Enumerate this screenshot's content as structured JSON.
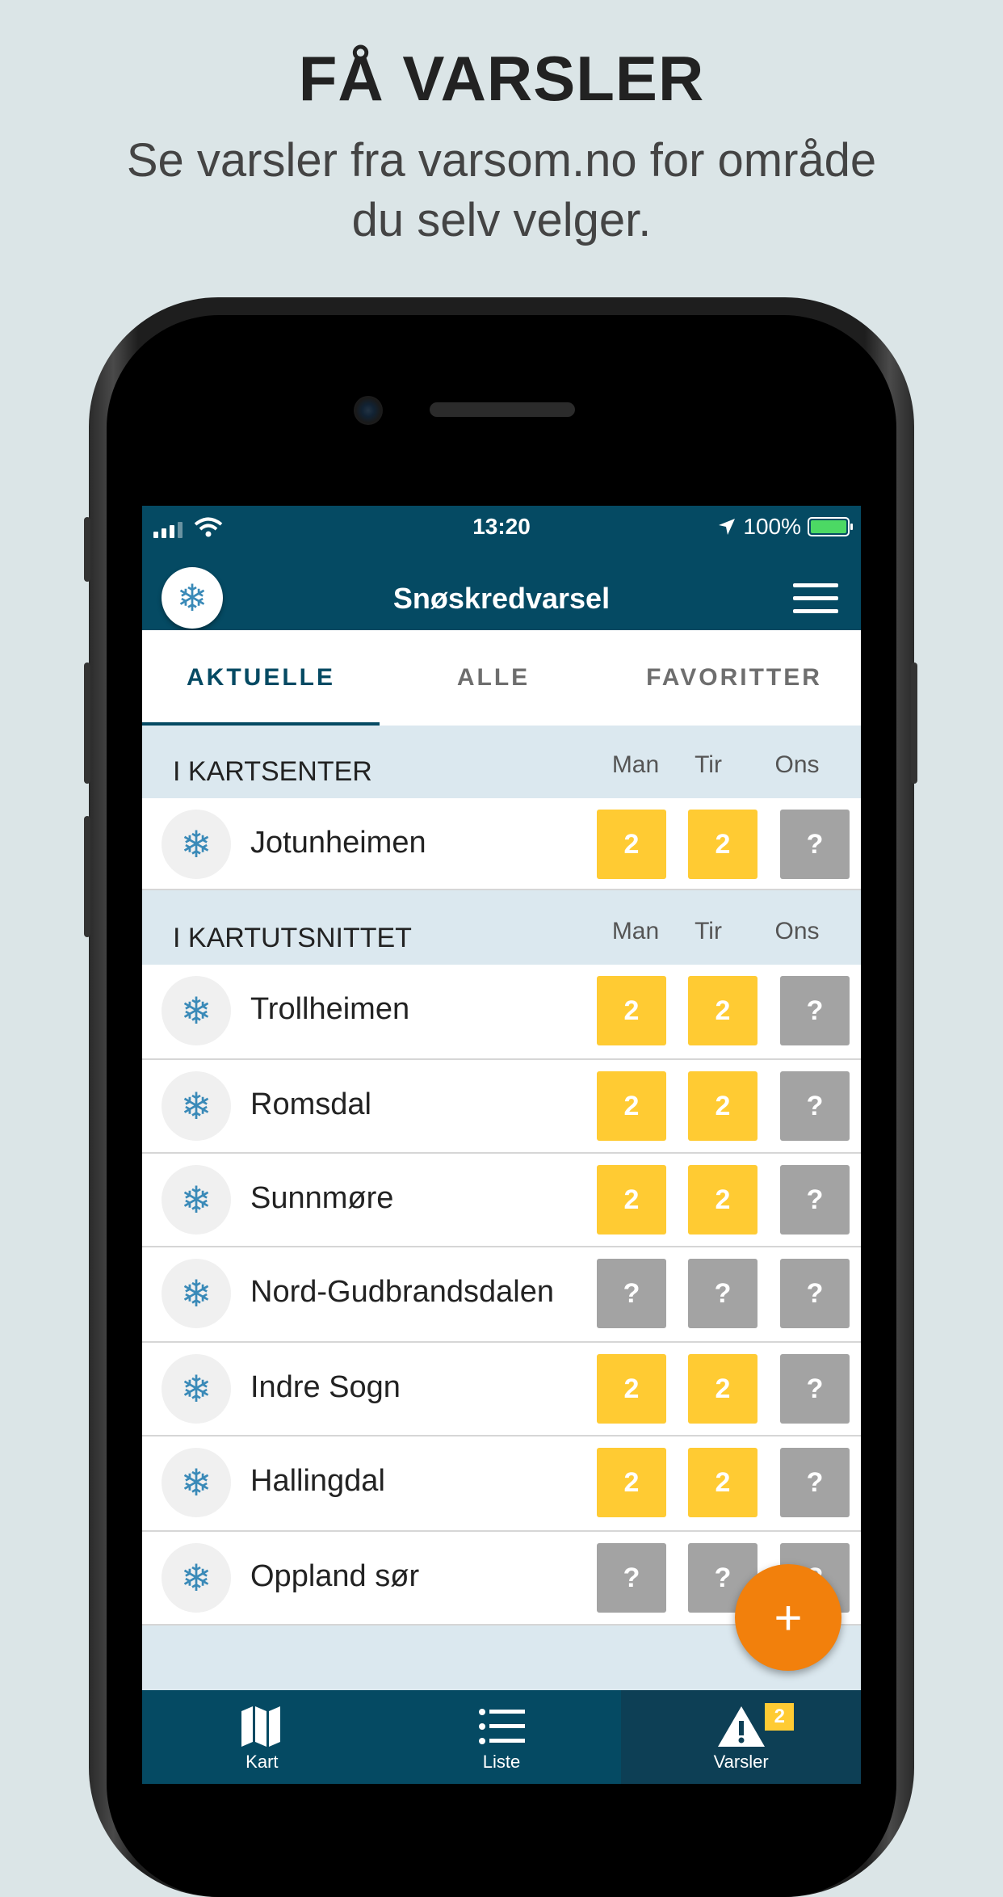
{
  "promo": {
    "headline": "FÅ VARSLER",
    "subline_1": "Se varsler fra varsom.no for område",
    "subline_2": "du selv velger."
  },
  "status_bar": {
    "time": "13:20",
    "battery": "100%"
  },
  "nav": {
    "title": "Snøskredvarsel",
    "avatar_icon": "snowflake-icon",
    "menu_icon": "hamburger-menu-icon"
  },
  "tabs": [
    {
      "label": "AKTUELLE",
      "active": true
    },
    {
      "label": "ALLE",
      "active": false
    },
    {
      "label": "FAVORITTER",
      "active": false
    }
  ],
  "days": [
    "Man",
    "Tir",
    "Ons"
  ],
  "sections": [
    {
      "title": "I KARTSENTER",
      "rows": [
        {
          "name": "Jotunheimen",
          "levels": [
            "2",
            "2",
            "?"
          ]
        }
      ]
    },
    {
      "title": "I KARTUTSNITTET",
      "rows": [
        {
          "name": "Trollheimen",
          "levels": [
            "2",
            "2",
            "?"
          ]
        },
        {
          "name": "Romsdal",
          "levels": [
            "2",
            "2",
            "?"
          ]
        },
        {
          "name": "Sunnmøre",
          "levels": [
            "2",
            "2",
            "?"
          ]
        },
        {
          "name": "Nord-Gudbrandsdalen",
          "levels": [
            "?",
            "?",
            "?"
          ]
        },
        {
          "name": "Indre Sogn",
          "levels": [
            "2",
            "2",
            "?"
          ]
        },
        {
          "name": "Hallingdal",
          "levels": [
            "2",
            "2",
            "?"
          ]
        },
        {
          "name": "Oppland sør",
          "levels": [
            "?",
            "?",
            "?"
          ]
        }
      ]
    }
  ],
  "fab": {
    "label": "+"
  },
  "bottom_tabs": [
    {
      "label": "Kart",
      "icon": "map-icon"
    },
    {
      "label": "Liste",
      "icon": "list-icon"
    },
    {
      "label": "Varsler",
      "icon": "warning-icon",
      "badge": "2",
      "active": true
    }
  ],
  "colors": {
    "primary": "#054a63",
    "level_2": "#ffcb33",
    "unknown": "#a3a3a3",
    "fab": "#f2800c"
  }
}
